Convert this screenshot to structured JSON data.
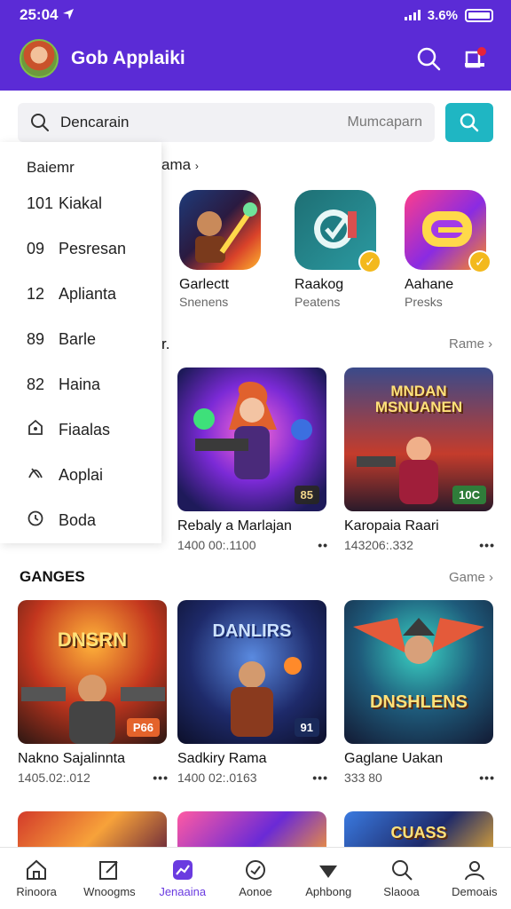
{
  "status": {
    "time": "25:04",
    "battery": "3.6%"
  },
  "header": {
    "title": "Gob Applaiki"
  },
  "search": {
    "value": "Dencarain",
    "placeholder": "Mumcaparn"
  },
  "dropdown": {
    "heading": "Baiemr",
    "items": [
      {
        "code": "101",
        "label": "Kiakal"
      },
      {
        "code": "09",
        "label": "Pesresan"
      },
      {
        "code": "12",
        "label": "Aplianta"
      },
      {
        "code": "89",
        "label": "Barle"
      },
      {
        "code": "82",
        "label": "Haina"
      },
      {
        "code": "",
        "label": "Fiaalas"
      },
      {
        "code": "",
        "label": "Aoplai"
      },
      {
        "code": "",
        "label": "Boda"
      }
    ]
  },
  "featured": {
    "title": "ama",
    "apps": [
      {
        "name": "Garlectt",
        "sub": "Snenens"
      },
      {
        "name": "Raakog",
        "sub": "Peatens"
      },
      {
        "name": "Aahane",
        "sub": "Presks"
      }
    ]
  },
  "section1": {
    "title": "r.",
    "more": "Rame",
    "cards": [
      {
        "title": "Rebaly a Marlajan",
        "meta": "1400 00:.1100",
        "badge": "85"
      },
      {
        "title": "Karopaia Raari",
        "meta": "143206:.332",
        "badge": "10C",
        "art": "MNDAN MSNUANEN"
      }
    ]
  },
  "section2": {
    "title": "GANGES",
    "more": "Game",
    "cards": [
      {
        "title": "Nakno Sajalinnta",
        "meta": "1405.02:.012",
        "badge": "P66",
        "art": "DNSRN"
      },
      {
        "title": "Sadkiry Rama",
        "meta": "1400 02:.0163",
        "badge": "91",
        "art": "DANLIRS"
      },
      {
        "title": "Gaglane Uakan",
        "meta": "333 80",
        "art": "DNSHLENS"
      }
    ]
  },
  "section3": {
    "art": "CUASS"
  },
  "bottom_nav": [
    {
      "label": "Rinoora",
      "icon": "home-icon"
    },
    {
      "label": "Wnoogms",
      "icon": "edit-icon"
    },
    {
      "label": "Jenaaina",
      "icon": "trending-icon",
      "active": true
    },
    {
      "label": "Aonoe",
      "icon": "gauge-icon"
    },
    {
      "label": "Aphbong",
      "icon": "pin-icon"
    },
    {
      "label": "Slaooa",
      "icon": "search-icon"
    },
    {
      "label": "Demoais",
      "icon": "user-icon"
    }
  ],
  "colors": {
    "header": "#5b2bd6",
    "accent": "#1fb6c3",
    "active": "#6a3be0"
  }
}
